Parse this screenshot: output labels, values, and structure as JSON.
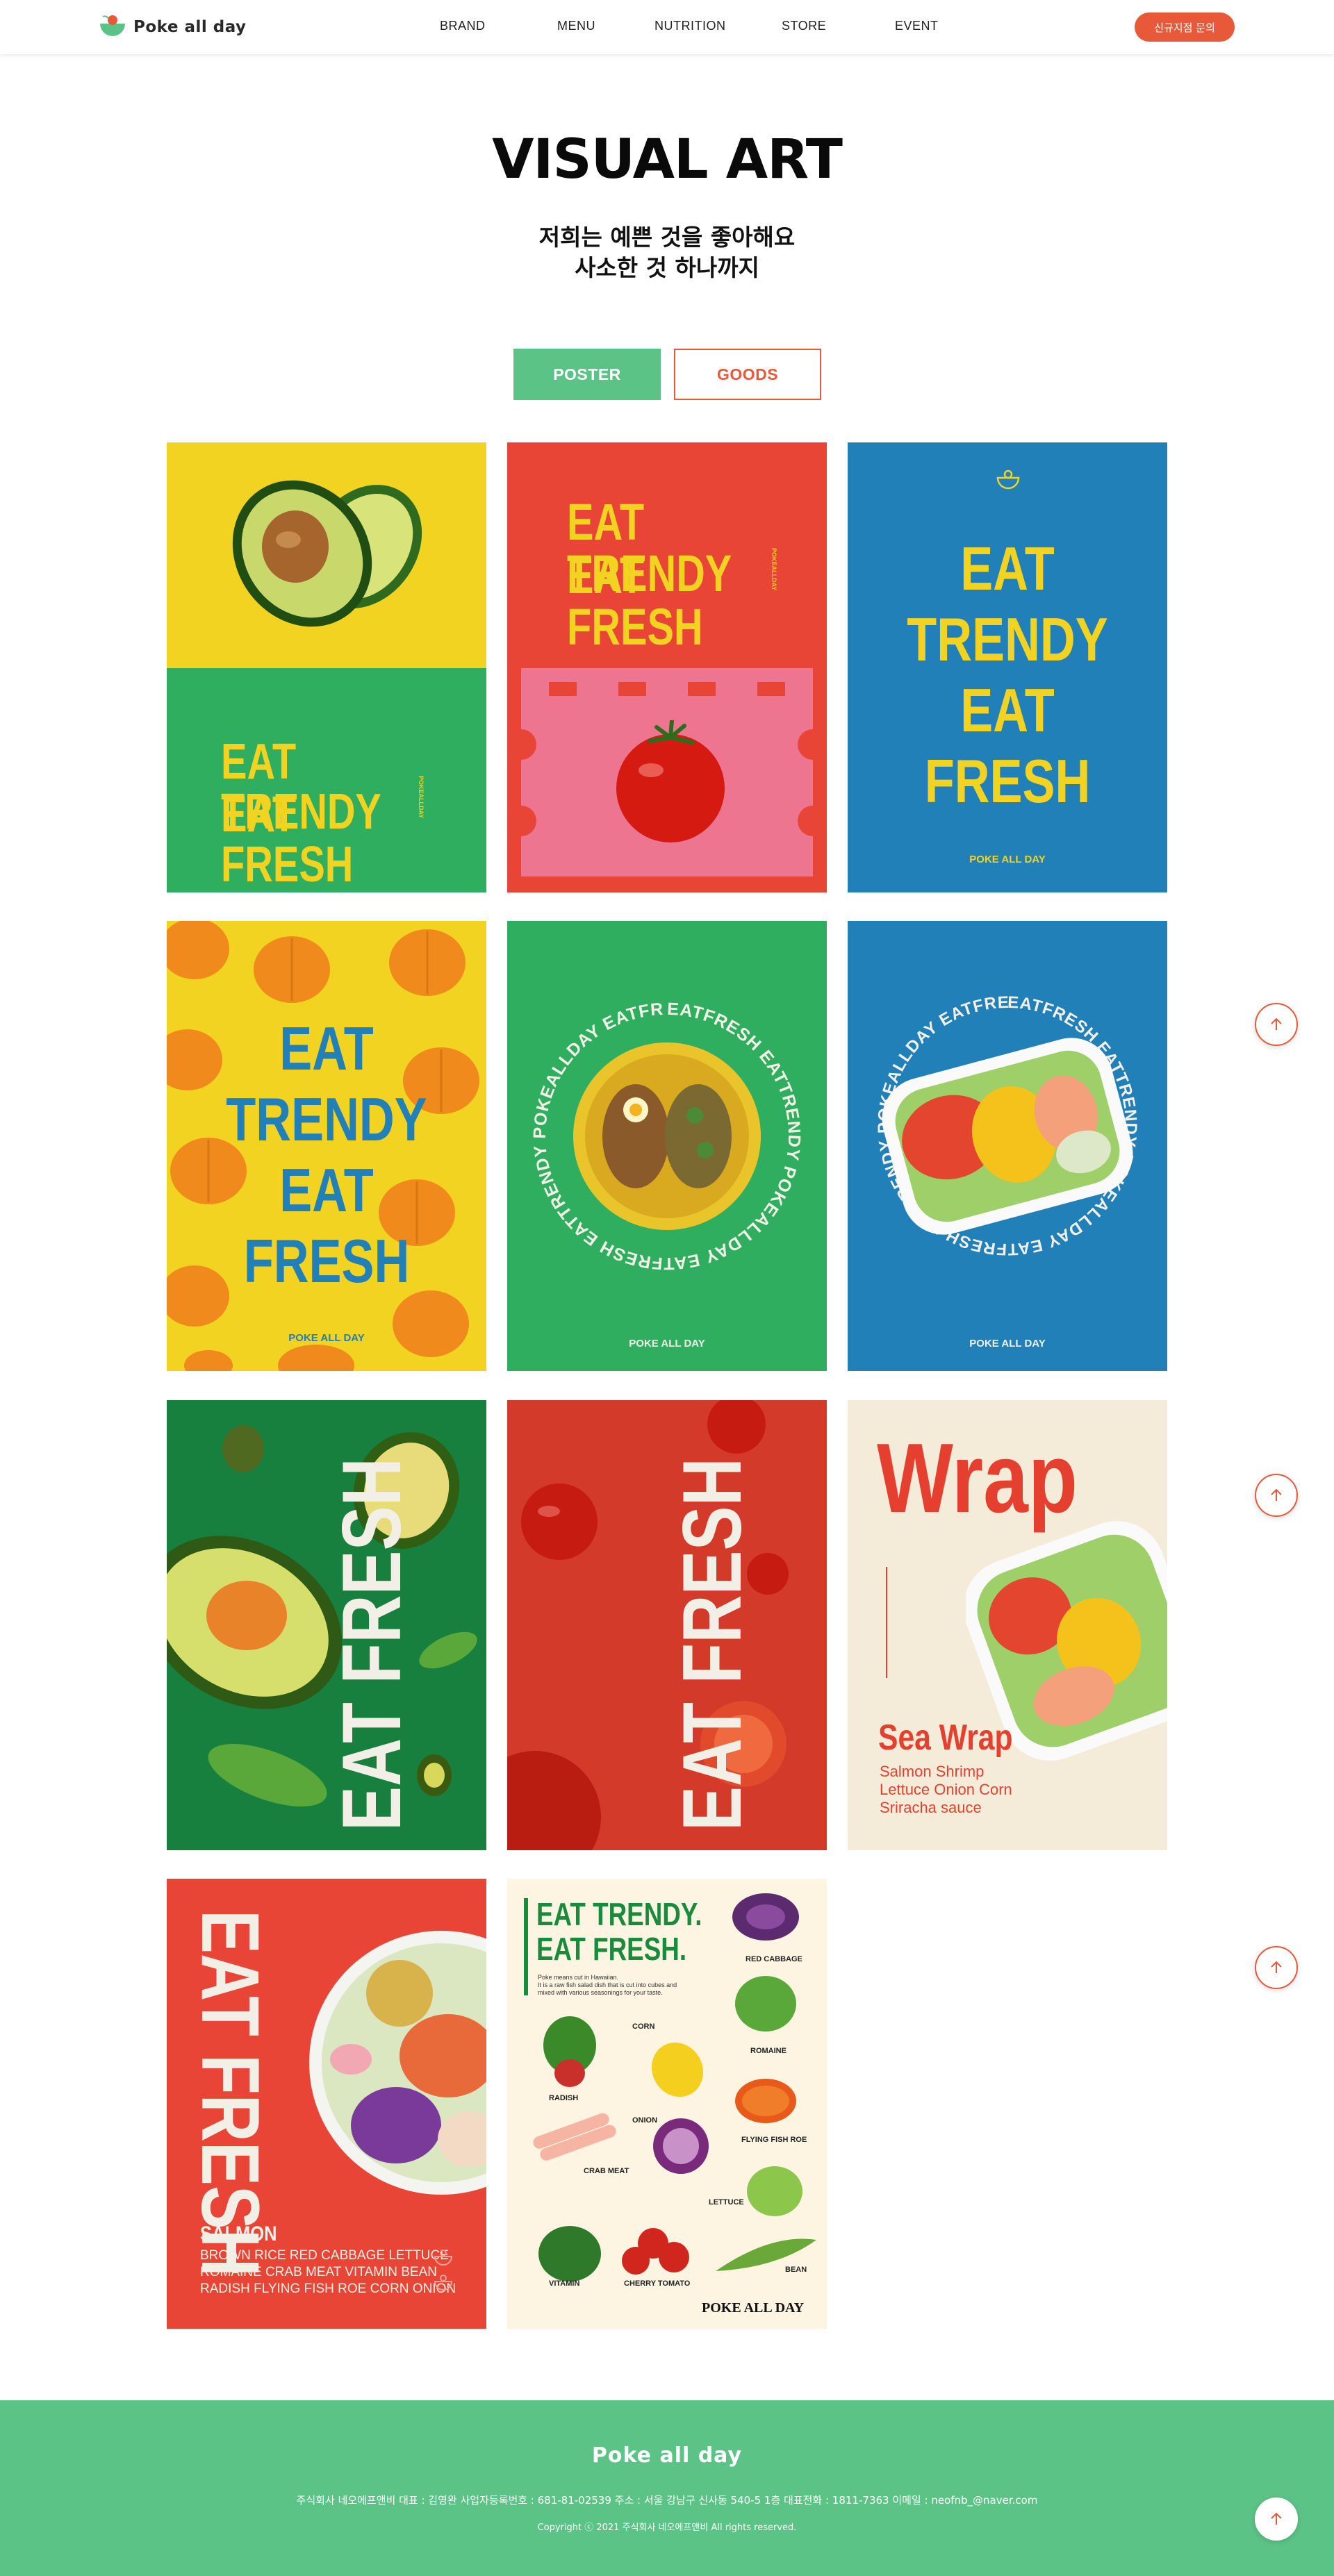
{
  "header": {
    "logo_text": "Poke all day",
    "nav": [
      "BRAND",
      "MENU",
      "NUTRITION",
      "STORE",
      "EVENT"
    ],
    "cta_label": "신규지점 문의"
  },
  "hero": {
    "title": "VISUAL ART",
    "subtitle_line1": "저희는 예쁜 것을 좋아해요",
    "subtitle_line2": "사소한 것 하나까지"
  },
  "tabs": [
    "POSTER",
    "GOODS"
  ],
  "colors": {
    "accent_orange": "#e8593a",
    "accent_green": "#5cc386",
    "poster_yellow": "#f2d322",
    "poster_green": "#2eae5e",
    "poster_red": "#e84537",
    "poster_blue": "#2280b8"
  },
  "posters": {
    "p1": {
      "line1": "EAT TRENDY",
      "line2": "EAT FRESH",
      "side": "POKEALLDAY"
    },
    "p2": {
      "line1": "EAT TRENDY",
      "line2": "EAT FRESH",
      "side": "POKEALLDAY"
    },
    "p3": {
      "l1": "EAT",
      "l2": "TRENDY",
      "l3": "EAT",
      "l4": "FRESH",
      "brand": "POKE ALL DAY"
    },
    "p4": {
      "l1": "EAT",
      "l2": "TRENDY",
      "l3": "EAT",
      "l4": "FRESH",
      "brand": "POKE ALL DAY"
    },
    "p5": {
      "ring": "EATFRESH EATTRENDY POKEALLDAY EATFRESH EATTRENDY POKEALLDAY EATFRESH EATTRENDY POKEALLDAY",
      "brand": "POKE ALL DAY"
    },
    "p6": {
      "ring": "EATFRESH EATTRENDY POKEALLDAY EATFRESH EATTRENDY POKEALLDAY EATFRESH EATTRENDY POKEALLDAY",
      "brand": "POKE ALL DAY"
    },
    "p7": {
      "text": "EAT FRESH"
    },
    "p8": {
      "text": "EAT FRESH"
    },
    "p9": {
      "title": "Wrap",
      "name": "Sea Wrap",
      "ing1": "Salmon  Shrimp",
      "ing2": "Lettuce  Onion  Corn",
      "ing3": "Sriracha  sauce"
    },
    "p10": {
      "text": "EAT FRESH",
      "name": "SALMON",
      "ing1": "BROWN RICE  RED CABBAGE  LETTUCE",
      "ing2": "ROMAINE  CRAB MEAT  VITAMIN  BEAN",
      "ing3": "RADISH  FLYING FISH ROE  CORN ONION"
    },
    "p11": {
      "title1": "EAT TRENDY.",
      "title2": "EAT FRESH.",
      "desc1": "Poke means cut in Hawaiian.",
      "desc2": "It is a raw fish salad dish that is cut into cubes and",
      "desc3": "mixed with various seasonings for your taste.",
      "labels": [
        "RED CABBAGE",
        "CORN",
        "ROMAINE",
        "RADISH",
        "ONION",
        "FLYING FISH ROE",
        "CRAB MEAT",
        "LETTUCE",
        "BEAN",
        "VITAMIN",
        "CHERRY TOMATO"
      ],
      "brand": "POKE ALL DAY"
    }
  },
  "footer": {
    "logo_text": "Poke all day",
    "info": "주식회사 네오에프앤비 대표 : 김영완 사업자등록번호 : 681-81-02539 주소 : 서울 강남구 신사동 540-5 1층 대표전화 : 1811-7363 이메일 : neofnb_@naver.com",
    "copyright": "Copyright ⓒ 2021 주식회사 네오에프앤비 All rights reserved."
  }
}
